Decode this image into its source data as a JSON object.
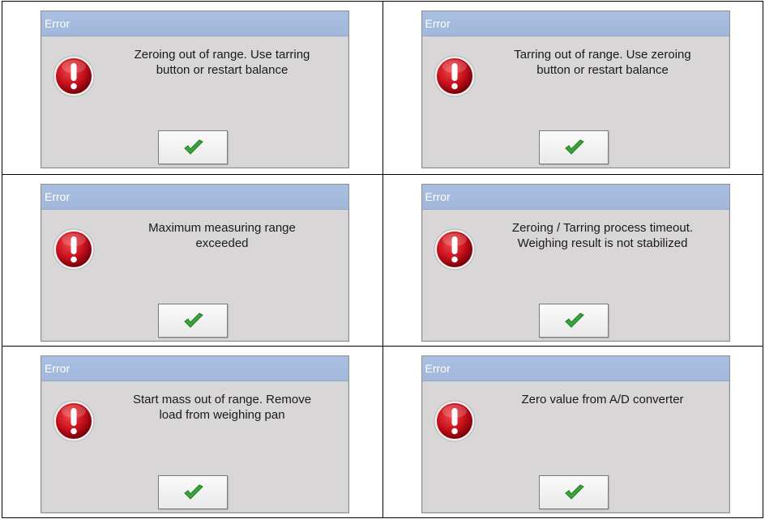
{
  "dialogs": [
    {
      "title": "Error",
      "message": "Zeroing out of range. Use tarring\nbutton or restart balance",
      "ok_icon": "checkmark-icon",
      "error_icon": "exclamation-icon"
    },
    {
      "title": "Error",
      "message": "Tarring out of range. Use zeroing\nbutton or restart balance",
      "ok_icon": "checkmark-icon",
      "error_icon": "exclamation-icon"
    },
    {
      "title": "Error",
      "message": "Maximum measuring range\nexceeded",
      "ok_icon": "checkmark-icon",
      "error_icon": "exclamation-icon"
    },
    {
      "title": "Error",
      "message": "Zeroing / Tarring process timeout.\nWeighing result is not stabilized",
      "ok_icon": "checkmark-icon",
      "error_icon": "exclamation-icon"
    },
    {
      "title": "Error",
      "message": "Start mass out of range. Remove\nload from weighing pan",
      "ok_icon": "checkmark-icon",
      "error_icon": "exclamation-icon"
    },
    {
      "title": "Error",
      "message": "Zero value from A/D converter",
      "ok_icon": "checkmark-icon",
      "error_icon": "exclamation-icon"
    }
  ],
  "colors": {
    "title_bar": "#a6bcde",
    "dialog_background": "#d9d6d8",
    "error_red": "#c8101c",
    "check_green": "#3aa53a"
  }
}
